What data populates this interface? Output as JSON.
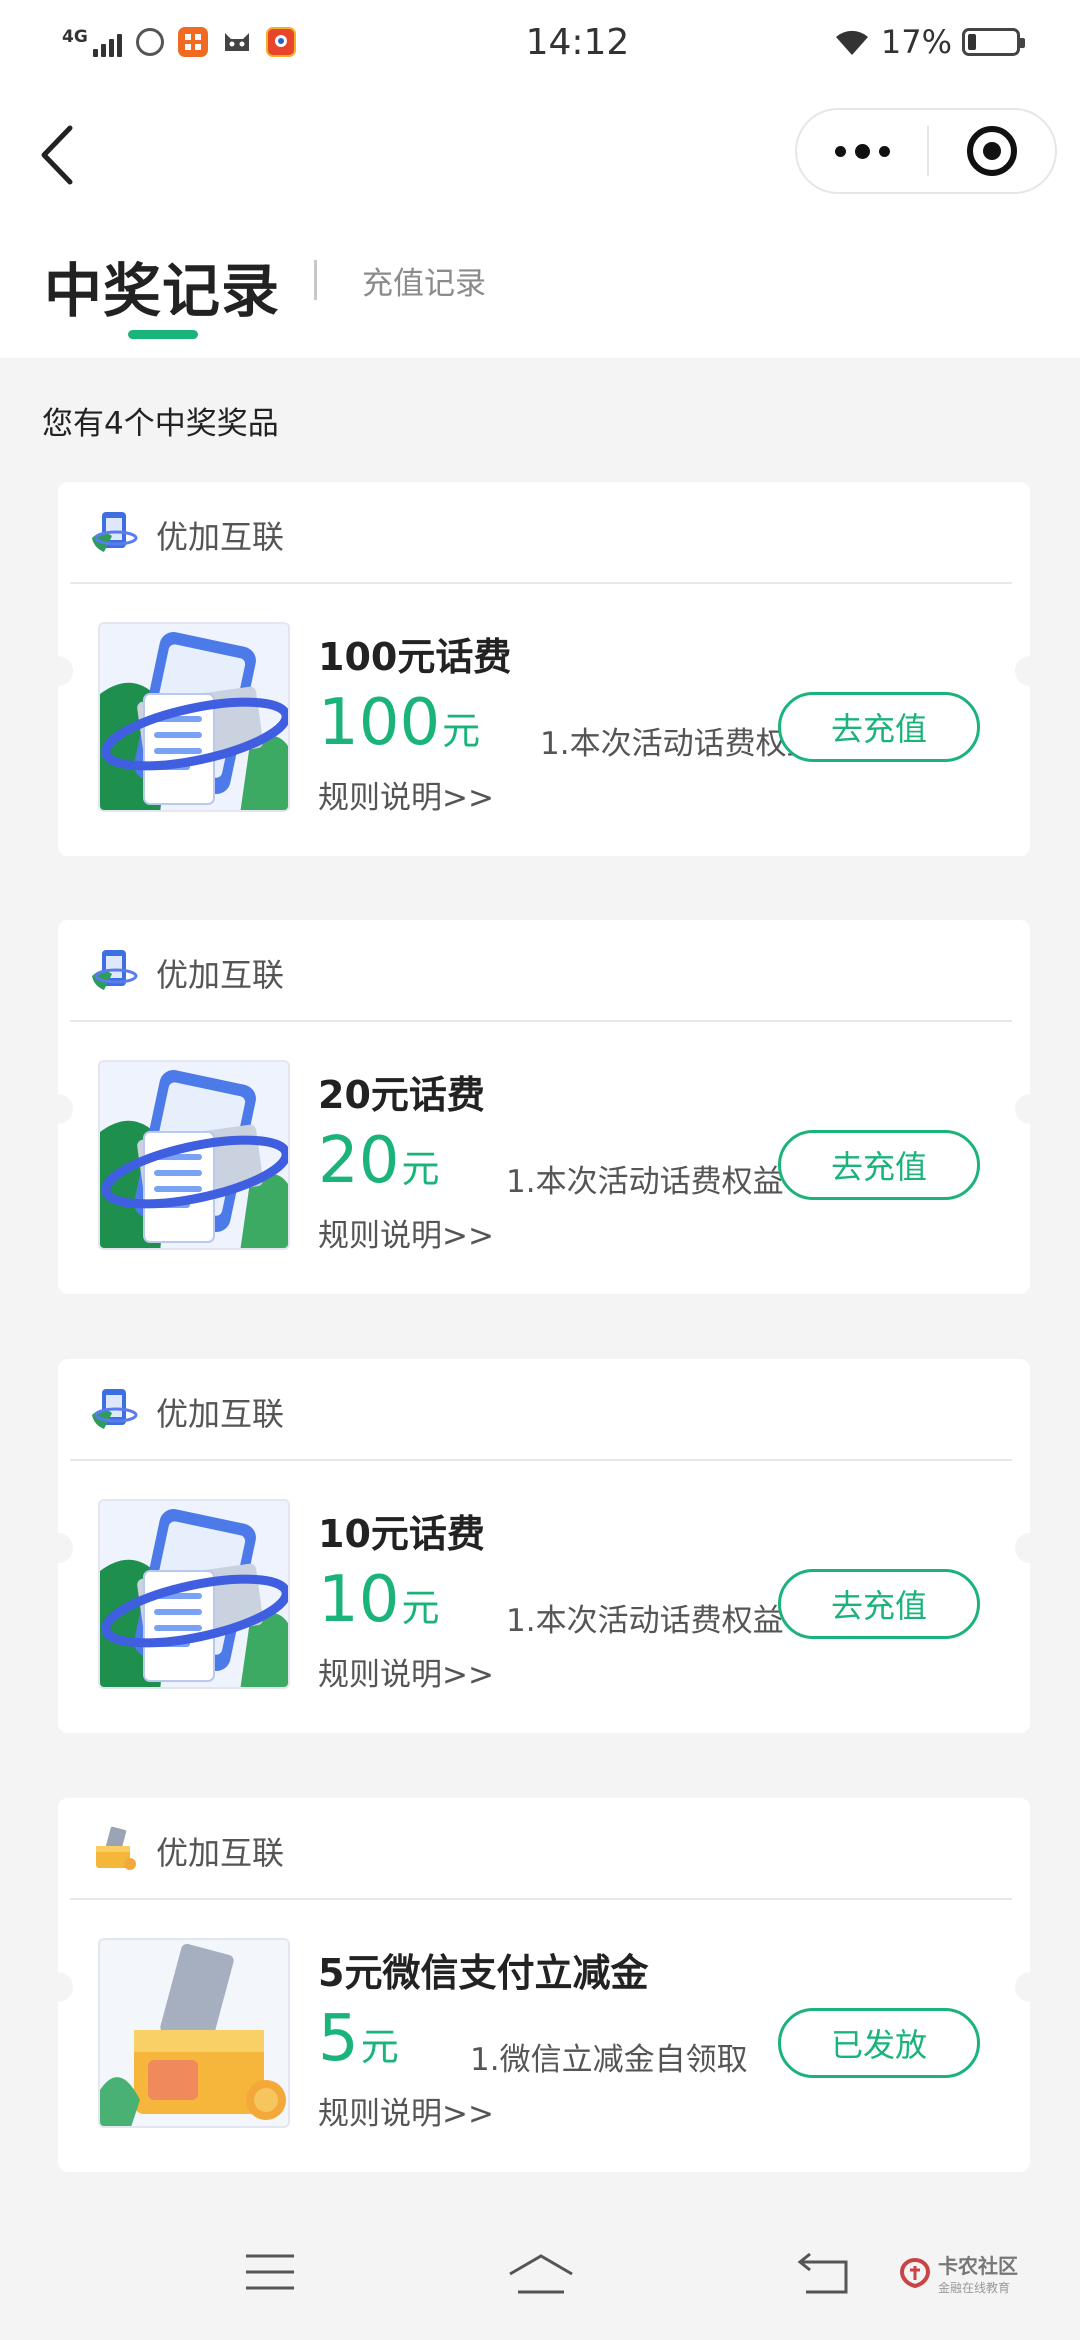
{
  "status_bar": {
    "network": "4G",
    "time": "14:12",
    "battery": "17%",
    "battery_level": 0.17
  },
  "tabs": {
    "active": "中奖记录",
    "other": "充值记录",
    "accent_color": "#1ab37a"
  },
  "summary": "您有4个中奖奖品",
  "prizes": [
    {
      "brand": "优加互联",
      "title": "100元话费",
      "amount": "100",
      "unit": "元",
      "desc": "1.本次活动话费权益",
      "rules": "规则说明>>",
      "action": "去充值",
      "icon": "phone-card-icon"
    },
    {
      "brand": "优加互联",
      "title": "20元话费",
      "amount": "20",
      "unit": "元",
      "desc": "1.本次活动话费权益",
      "rules": "规则说明>>",
      "action": "去充值",
      "icon": "phone-card-icon"
    },
    {
      "brand": "优加互联",
      "title": "10元话费",
      "amount": "10",
      "unit": "元",
      "desc": "1.本次活动话费权益",
      "rules": "规则说明>>",
      "action": "去充值",
      "icon": "phone-card-icon"
    },
    {
      "brand": "优加互联",
      "title": "5元微信支付立减金",
      "amount": "5",
      "unit": "元",
      "desc": "1.微信立减金自领取",
      "rules": "规则说明>>",
      "action": "已发放",
      "icon": "card-box-icon"
    }
  ],
  "watermark": {
    "main": "卡农社区",
    "sub": "金融在线教育"
  }
}
